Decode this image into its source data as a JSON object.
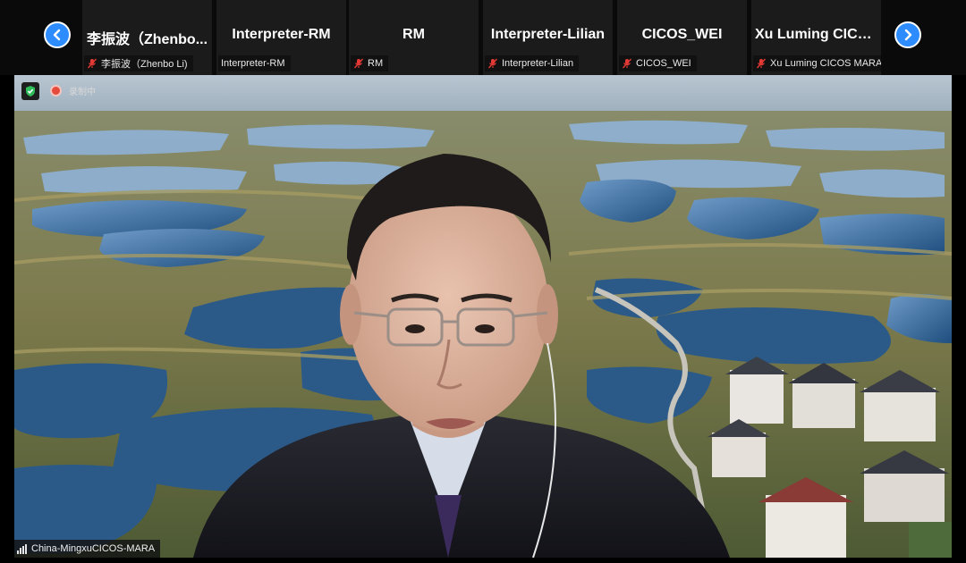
{
  "strip": {
    "prev_icon": "chevron-left-icon",
    "next_icon": "chevron-right-icon",
    "participants": [
      {
        "name": "李振波（Zhenbo...",
        "label": "李振波（Zhenbo Li)"
      },
      {
        "name": "Interpreter-RM",
        "label": "Interpreter-RM"
      },
      {
        "name": "RM",
        "label": "RM"
      },
      {
        "name": "Interpreter-Lilian",
        "label": "Interpreter-Lilian"
      },
      {
        "name": "CICOS_WEI",
        "label": "CICOS_WEI"
      },
      {
        "name": "Xu Luming CICO...",
        "label": "Xu Luming CICOS MARA"
      }
    ],
    "mute_icon": "microphone-muted-icon",
    "accent": "#2d8cff"
  },
  "main": {
    "security_icon": "shield-check-icon",
    "recording_icon": "recording-dot-icon",
    "recording_label": "录制中",
    "speaker_name": "China-MingxuCICOS-MARA",
    "signal_icon": "signal-bars-icon"
  }
}
